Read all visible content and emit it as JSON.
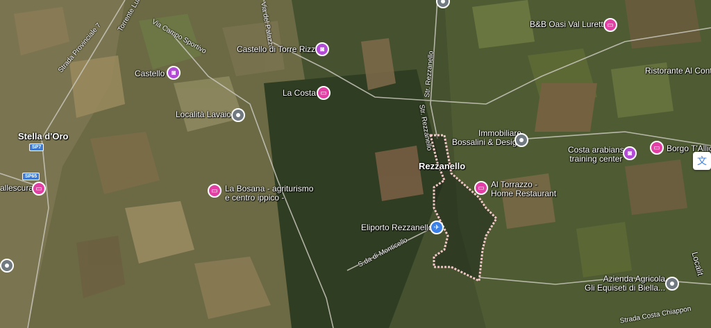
{
  "colors": {
    "hotel": "#e13fa4",
    "photo": "#b34bd6",
    "place": "#707a80",
    "airport": "#3b80e6",
    "boundary": "#f2c6c6"
  },
  "labels": {
    "stella": "Stella d'Oro",
    "rezzanello": "Rezzanello",
    "vallescura": "allescura",
    "castello_torre": "Castello di Torre Rizzi",
    "castello": "Castello",
    "la_costa": "La Costa",
    "localita": "Località Lavaio",
    "bosana": "La Bosana - agriturismo\ne centro ippico -",
    "immobiliare": "Immobiliare\nBossalini & Design",
    "torrazzo": "Al Torrazzo -\nHome Restaurant",
    "eliporto": "Eliporto Rezzanello",
    "bb": "B&B Oasi Val Luretta",
    "ristorante": "Ristorante Al Conte",
    "costa_arabians": "Costa arabians\ntraining center",
    "borgo": "Borgo T'Allic",
    "azienda": "Azienda Agricola\nGli Equiseti di Biella...",
    "localita_right": "Localit"
  },
  "roads": {
    "sp7": "SP7",
    "sp65": "SP65",
    "strada_prov": "Strada Provinciale 7",
    "torrente": "Torrente Luret",
    "campo": "Via Campo Sportivo",
    "palazzo": "Via del Palazzo",
    "rezz1": "Str. Rezzanello",
    "rezz2": "Str. Rezzanello",
    "monticello": "S.da di Monticello",
    "chiappone": "Strada Costa Chiappon"
  }
}
